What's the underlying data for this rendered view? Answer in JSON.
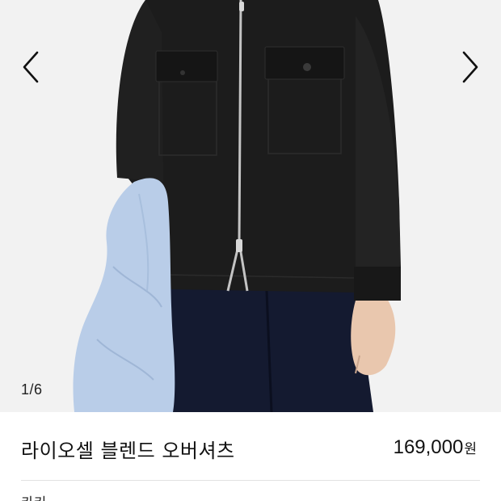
{
  "gallery": {
    "counter": "1/6",
    "prev_icon": "chevron-left-icon",
    "next_icon": "chevron-right-icon",
    "colors": {
      "background": "#f2f2f2",
      "shirt": "#1c1c1c",
      "pants": "#141a30",
      "jacket": "#b9cde8",
      "skin": "#e9c7ae"
    }
  },
  "product": {
    "name": "라이오셀 블렌드 오버셔츠",
    "price": "169,000",
    "currency": "원",
    "color": "카키"
  }
}
